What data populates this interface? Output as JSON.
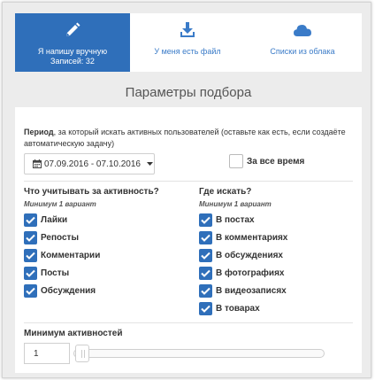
{
  "tabs": [
    {
      "label": "Я напишу вручную",
      "sublabel": "Записей: 32",
      "icon": "pencil-icon",
      "active": true
    },
    {
      "label": "У меня есть файл",
      "icon": "download-icon",
      "active": false
    },
    {
      "label": "Списки из облака",
      "icon": "cloud-icon",
      "active": false
    }
  ],
  "section_title": "Параметры подбора",
  "period": {
    "label": "Период",
    "description": ", за который искать активных пользователей (оставьте как есть, если создаёте автоматическую задачу)",
    "date_range": "07.09.2016 - 07.10.2016",
    "all_time_label": "За все время",
    "all_time_checked": false
  },
  "activity": {
    "title": "Что учитывать за активность?",
    "hint": "Минимум 1 вариант",
    "options": [
      {
        "label": "Лайки",
        "checked": true
      },
      {
        "label": "Репосты",
        "checked": true
      },
      {
        "label": "Комментарии",
        "checked": true
      },
      {
        "label": "Посты",
        "checked": true
      },
      {
        "label": "Обсуждения",
        "checked": true
      }
    ]
  },
  "where": {
    "title": "Где искать?",
    "hint": "Минимум 1 вариант",
    "options": [
      {
        "label": "В постах",
        "checked": true
      },
      {
        "label": "В комментариях",
        "checked": true
      },
      {
        "label": "В обсуждениях",
        "checked": true
      },
      {
        "label": "В фотографиях",
        "checked": true
      },
      {
        "label": "В видеозаписях",
        "checked": true
      },
      {
        "label": "В товарах",
        "checked": true
      }
    ]
  },
  "min_activity": {
    "label": "Минимум активностей",
    "value": "1",
    "slider_fraction": 0
  },
  "colors": {
    "accent": "#2f6fba",
    "link": "#3a7bc8",
    "background": "#ececec"
  }
}
